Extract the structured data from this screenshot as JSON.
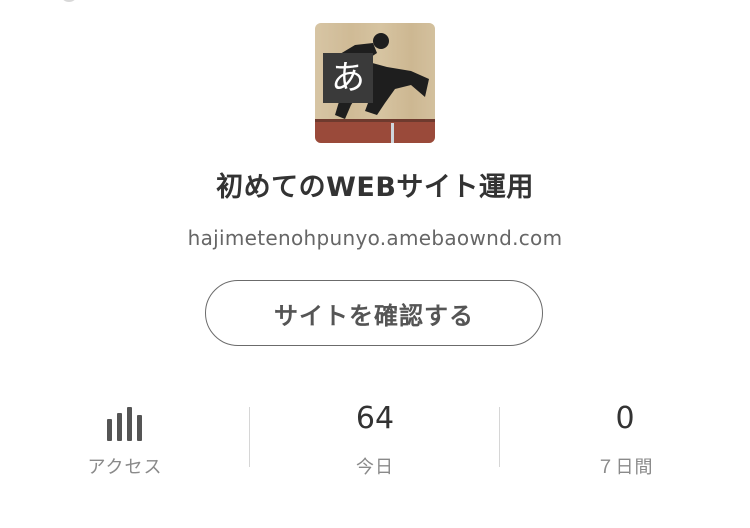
{
  "site": {
    "thumbnail_glyph": "あ",
    "title": "初めてのWEBサイト運用",
    "url": "hajimetenohpunyo.amebaownd.com",
    "check_button_label": "サイトを確認する"
  },
  "stats": {
    "access_icon": "bar-chart-icon",
    "access_label": "アクセス",
    "today_value": "64",
    "today_label": "今日",
    "week_value": "0",
    "week_label": "７日間"
  },
  "colors": {
    "text_primary": "#333333",
    "text_secondary": "#8a8a8a",
    "button_border": "#6b6b6b",
    "divider": "#d6d6d6"
  }
}
